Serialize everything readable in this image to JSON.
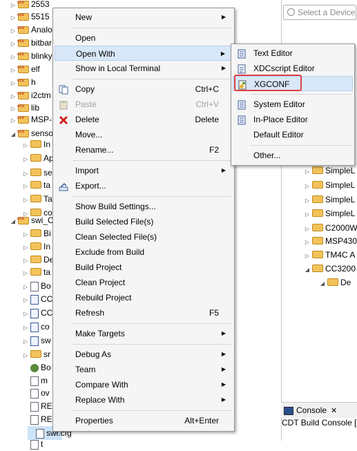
{
  "explorer": {
    "rows": [
      {
        "label": "2553"
      },
      {
        "label": "5515"
      },
      {
        "label": "Analo"
      },
      {
        "label": "bitbar"
      },
      {
        "label": "blinky"
      },
      {
        "label": "elf"
      },
      {
        "label": "h"
      },
      {
        "label": "i2ctm"
      },
      {
        "label": "lib"
      },
      {
        "label": "MSP-"
      },
      {
        "label": "senso"
      },
      {
        "label": "In"
      },
      {
        "label": "Ap"
      },
      {
        "label": "se"
      },
      {
        "label": "ta"
      },
      {
        "label": "Ta"
      },
      {
        "label": "co"
      },
      {
        "label": "swi_C"
      },
      {
        "label": "Bi"
      },
      {
        "label": "In"
      },
      {
        "label": "De"
      },
      {
        "label": "ta"
      },
      {
        "label": "Bo"
      },
      {
        "label": "CC"
      },
      {
        "label": "CC"
      },
      {
        "label": "co"
      },
      {
        "label": "sw"
      },
      {
        "label": "sr"
      },
      {
        "label": "Bo"
      },
      {
        "label": "m"
      },
      {
        "label": "ov"
      },
      {
        "label": "RE"
      },
      {
        "label": "RE"
      },
      {
        "label": "swi.cfg"
      },
      {
        "label": "t"
      }
    ]
  },
  "right_panel": {
    "search_placeholder": "Select a Device",
    "tree": [
      {
        "label": "SimpleL"
      },
      {
        "label": "SimpleL"
      },
      {
        "label": "SimpleL"
      },
      {
        "label": "SimpleL"
      },
      {
        "label": "C2000W"
      },
      {
        "label": "MSP430"
      },
      {
        "label": "TM4C A"
      },
      {
        "label": "CC3200"
      },
      {
        "label": "De"
      }
    ],
    "console_tab": "Console",
    "console_text": "CDT Build Console [s"
  },
  "context_menu": {
    "items": [
      {
        "label": "New",
        "submenu": true
      },
      {
        "sep": true
      },
      {
        "label": "Open"
      },
      {
        "label": "Open With",
        "submenu": true,
        "highlighted": true
      },
      {
        "label": "Show in Local Terminal",
        "submenu": true
      },
      {
        "sep": true
      },
      {
        "label": "Copy",
        "shortcut": "Ctrl+C",
        "icon": "copy-icon"
      },
      {
        "label": "Paste",
        "shortcut": "Ctrl+V",
        "icon": "paste-icon",
        "disabled": true
      },
      {
        "label": "Delete",
        "shortcut": "Delete",
        "icon": "delete-icon"
      },
      {
        "label": "Move..."
      },
      {
        "label": "Rename...",
        "shortcut": "F2"
      },
      {
        "sep": true
      },
      {
        "label": "Import",
        "submenu": true
      },
      {
        "label": "Export...",
        "icon": "export-icon"
      },
      {
        "sep": true
      },
      {
        "label": "Show Build Settings..."
      },
      {
        "label": "Build Selected File(s)"
      },
      {
        "label": "Clean Selected File(s)"
      },
      {
        "label": "Exclude from Build"
      },
      {
        "label": "Build Project"
      },
      {
        "label": "Clean Project"
      },
      {
        "label": "Rebuild Project"
      },
      {
        "label": "Refresh",
        "shortcut": "F5"
      },
      {
        "sep": true
      },
      {
        "label": "Make Targets",
        "submenu": true
      },
      {
        "sep": true
      },
      {
        "label": "Debug As",
        "submenu": true
      },
      {
        "label": "Team",
        "submenu": true
      },
      {
        "label": "Compare With",
        "submenu": true
      },
      {
        "label": "Replace With",
        "submenu": true
      },
      {
        "sep": true
      },
      {
        "label": "Properties",
        "shortcut": "Alt+Enter"
      }
    ]
  },
  "open_with_menu": {
    "items": [
      {
        "label": "Text Editor",
        "icon": "text-editor-icon"
      },
      {
        "label": "XDCscript Editor",
        "icon": "xdcscript-editor-icon"
      },
      {
        "label": "XGCONF",
        "icon": "xgconf-icon",
        "highlighted": true
      },
      {
        "sep": true
      },
      {
        "label": "System Editor",
        "icon": "system-editor-icon"
      },
      {
        "label": "In-Place Editor",
        "icon": "in-place-editor-icon"
      },
      {
        "label": "Default Editor"
      },
      {
        "sep": true
      },
      {
        "label": "Other..."
      }
    ]
  },
  "colors": {
    "highlight": "#d9e8f9",
    "annotation_box": "#e04040"
  }
}
